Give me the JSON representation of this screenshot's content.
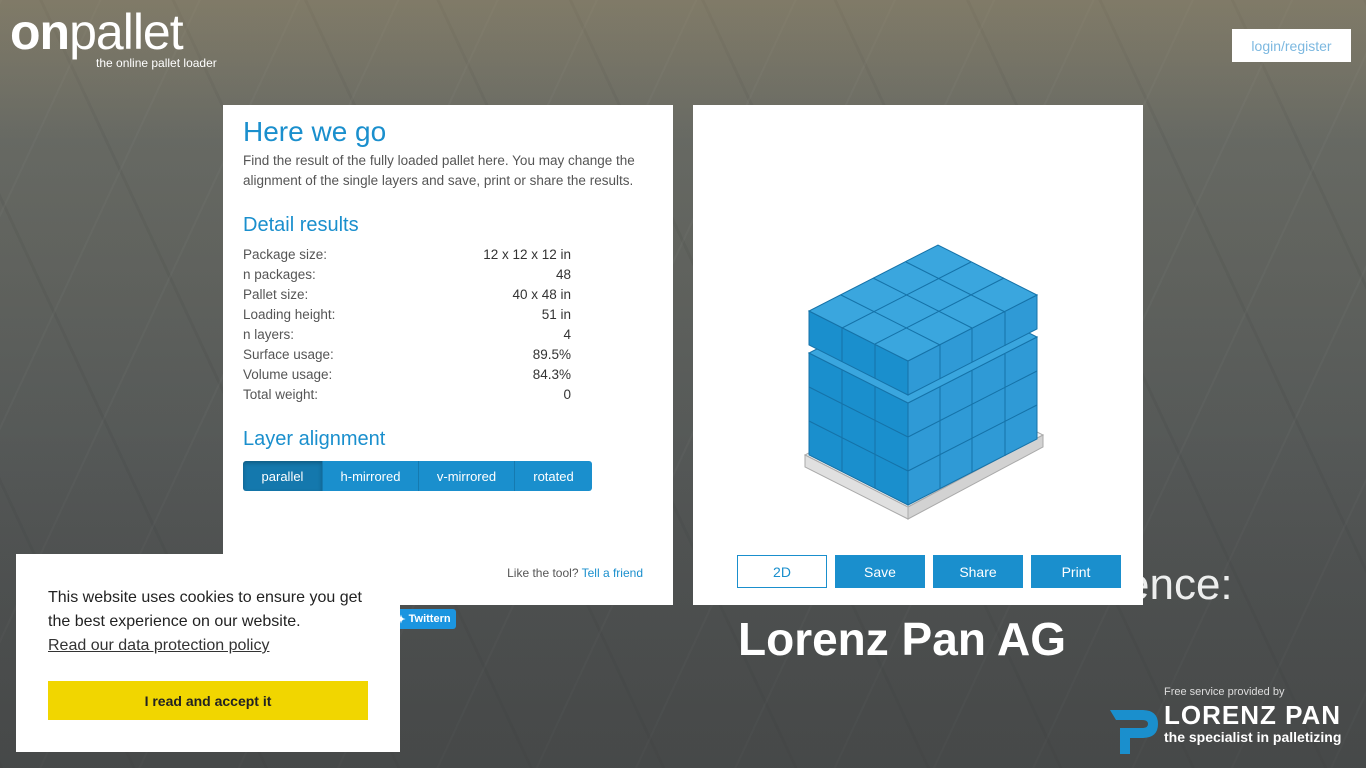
{
  "logo": {
    "bold": "on",
    "light": "pallet",
    "tagline": "the online pallet loader"
  },
  "header": {
    "login_label": "login/register"
  },
  "intro": {
    "title": "Here we go",
    "text": "Find the result of the fully loaded pallet here. You may change the alignment of the single layers and save, print or share the results."
  },
  "details": {
    "title": "Detail results",
    "rows": [
      {
        "label": "Package size:",
        "value": "12 x 12 x 12 in"
      },
      {
        "label": "n packages:",
        "value": "48"
      },
      {
        "label": "Pallet size:",
        "value": "40 x 48 in"
      },
      {
        "label": "Loading height:",
        "value": "51 in"
      },
      {
        "label": "n layers:",
        "value": "4"
      },
      {
        "label": "Surface usage:",
        "value": "89.5%"
      },
      {
        "label": "Volume usage:",
        "value": "84.3%"
      },
      {
        "label": "Total weight:",
        "value": "0"
      }
    ]
  },
  "layer_alignment": {
    "title": "Layer alignment",
    "options": [
      "parallel",
      "h-mirrored",
      "v-mirrored",
      "rotated"
    ],
    "selected": "parallel"
  },
  "like": {
    "text": "Like the tool?",
    "link": "Tell a friend"
  },
  "actions": {
    "view_2d": "2D",
    "save": "Save",
    "share": "Share",
    "print": "Print"
  },
  "background": {
    "headline": "Lorenz Pan AG",
    "partial": "ence:"
  },
  "tweet": {
    "label": "Twittern"
  },
  "brand": {
    "small": "Free service provided by",
    "name": "LORENZ PAN",
    "tagline": "the specialist in palletizing"
  },
  "cookie": {
    "text": "This website uses cookies to ensure you get the best experience on our website.",
    "link": "Read our data protection policy",
    "accept": "I read and accept it"
  },
  "colors": {
    "accent": "#1a8fcd",
    "box_top": "#3aa6de",
    "box_left": "#1a8fcd",
    "box_right": "#2f9ad6",
    "cookie_button": "#f1d600"
  }
}
